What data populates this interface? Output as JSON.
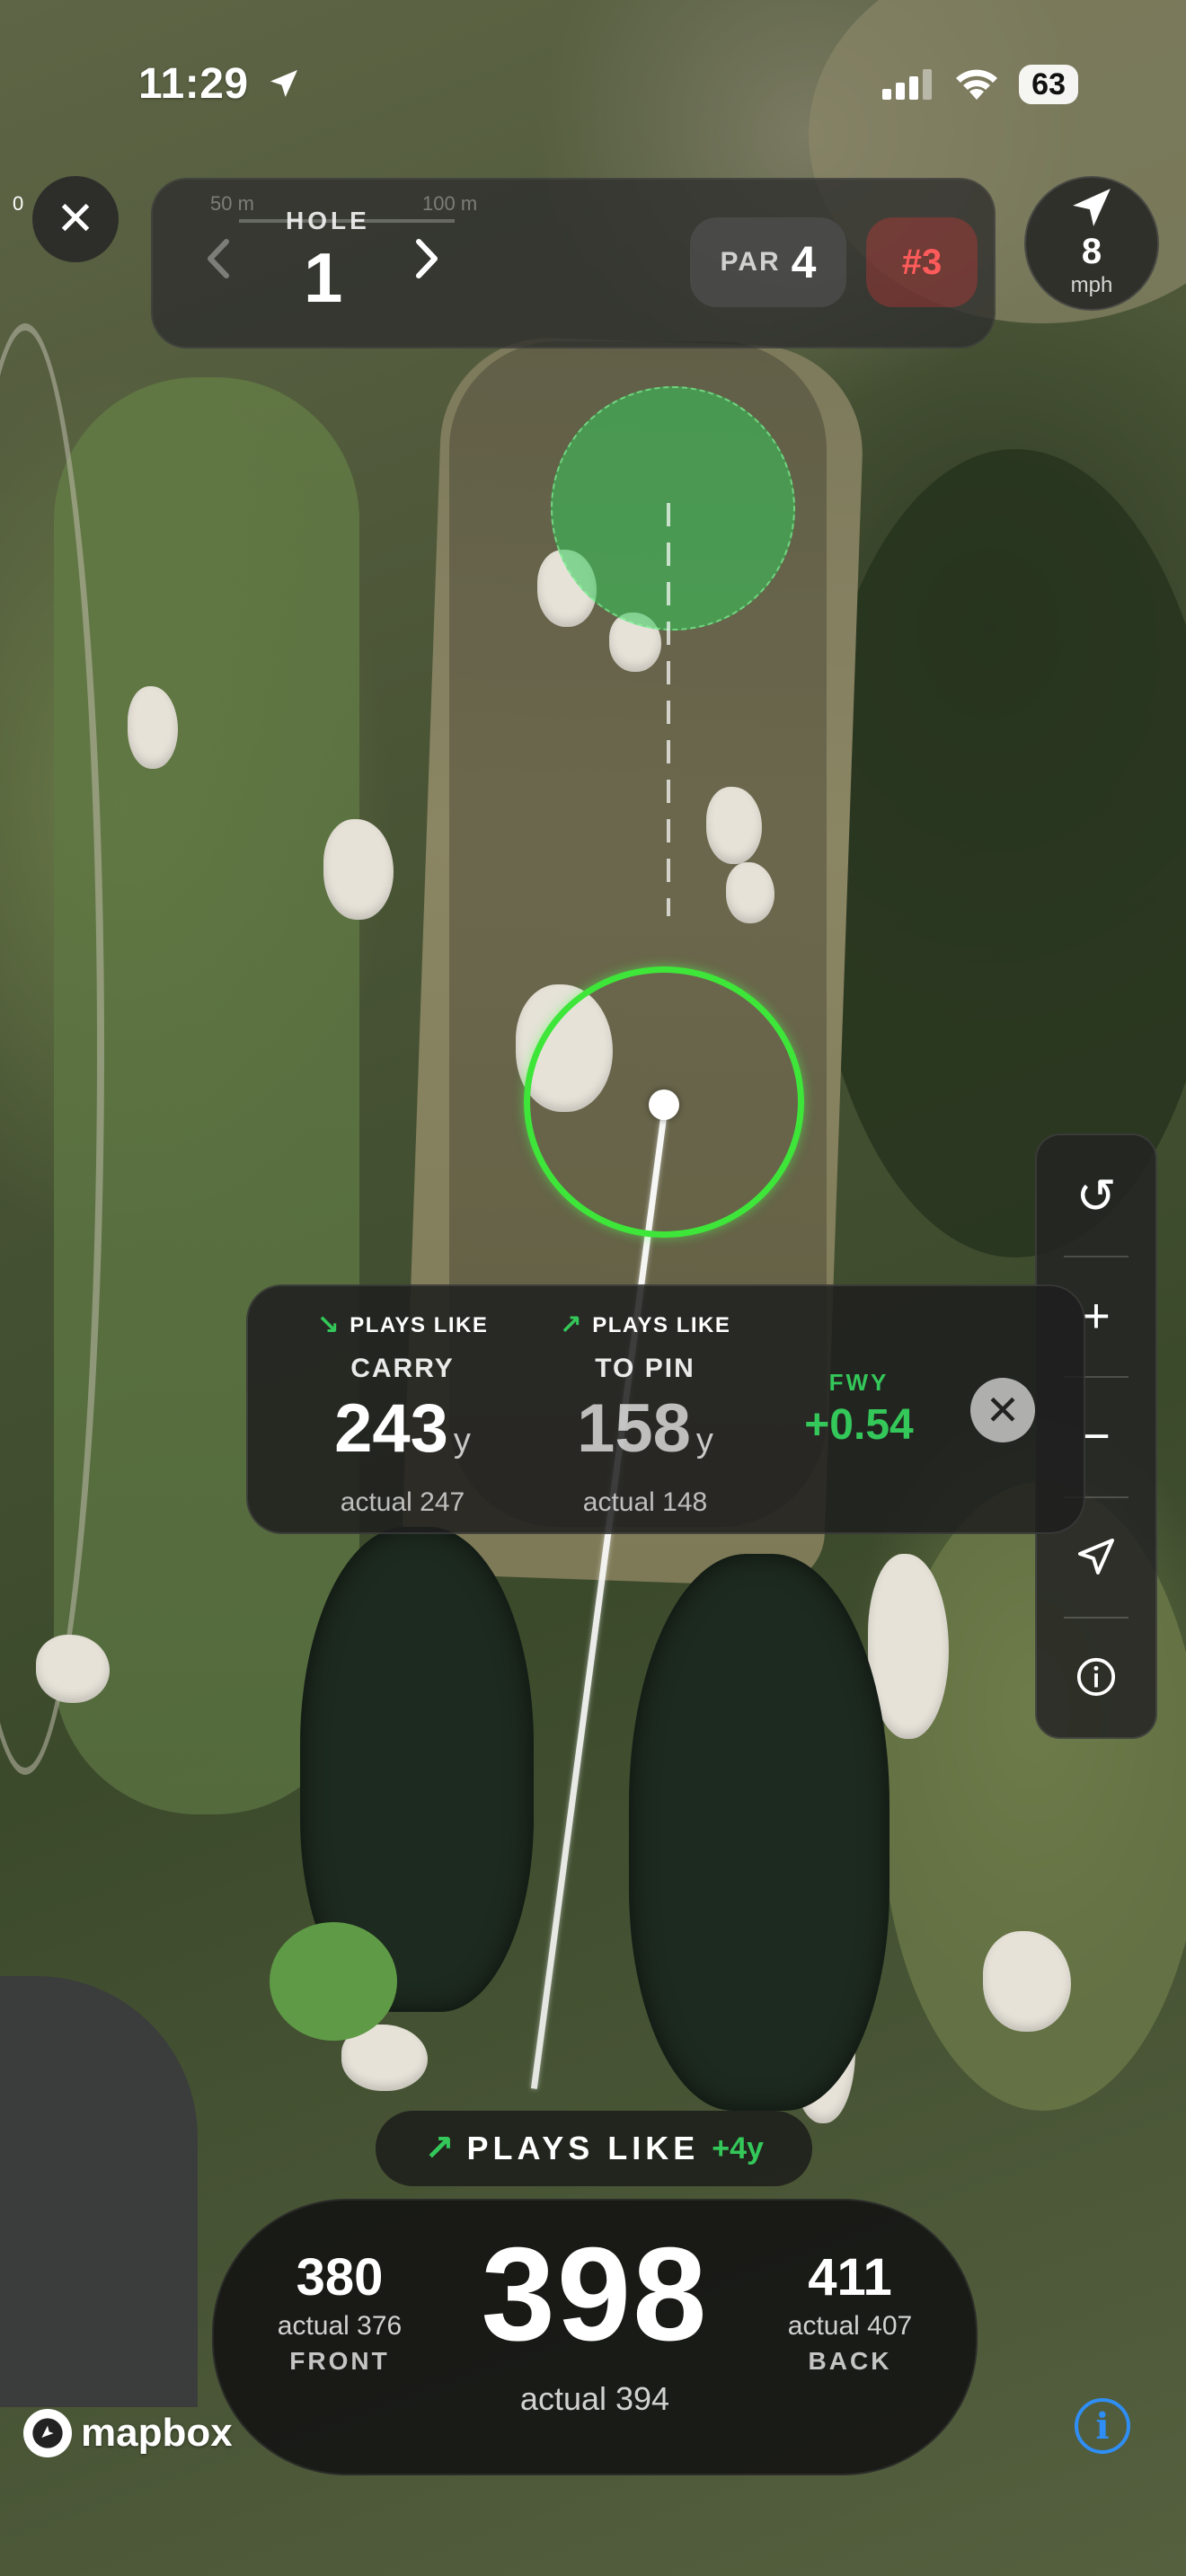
{
  "status_bar": {
    "time": "11:29",
    "battery": "63",
    "icons": [
      "location-arrow-icon",
      "cellular-signal-icon",
      "wifi-icon",
      "battery-icon"
    ]
  },
  "map": {
    "scale_zero": "0",
    "scale_left": "50 m",
    "scale_right": "100 m",
    "colors": {
      "target_ring": "#3ee63a",
      "green_zone": "#34c759",
      "accent_green": "#34c759",
      "hcp_red": "#ff5b5b",
      "info_blue": "#2f8ef5"
    }
  },
  "close_button": {
    "icon": "close-icon",
    "label": "✕"
  },
  "hole_header": {
    "label": "HOLE",
    "number": "1",
    "prev_icon": "chevron-left-icon",
    "next_icon": "chevron-right-icon",
    "par_label": "PAR",
    "par_value": "4",
    "handicap": "#3"
  },
  "wind": {
    "speed": "8",
    "unit": "mph",
    "icon": "wind-direction-arrow-icon"
  },
  "toolbar": {
    "items": [
      {
        "name": "reset-rotation",
        "icon": "rotate-ccw-icon",
        "glyph": "↺"
      },
      {
        "name": "zoom-in",
        "icon": "plus-icon",
        "glyph": "+"
      },
      {
        "name": "zoom-out",
        "icon": "minus-icon",
        "glyph": "−"
      },
      {
        "name": "locate",
        "icon": "location-arrow-icon",
        "glyph": "➤"
      },
      {
        "name": "info",
        "icon": "info-icon",
        "glyph": "ⓘ"
      }
    ]
  },
  "plays_like_card": {
    "carry": {
      "header": "PLAYS LIKE",
      "arrow": "↘",
      "label": "CARRY",
      "value": "243",
      "unit": "y",
      "actual": "actual 247"
    },
    "to_pin": {
      "header": "PLAYS LIKE",
      "arrow": "↗",
      "label": "TO PIN",
      "value": "158",
      "unit": "y",
      "actual": "actual 148"
    },
    "fwy": {
      "label": "FWY",
      "value": "+0.54"
    },
    "close_glyph": "✕"
  },
  "plays_like_pill": {
    "arrow": "↗",
    "label": "PLAYS LIKE",
    "value": "+4y"
  },
  "distances": {
    "front": {
      "value": "380",
      "actual": "actual 376",
      "label": "FRONT"
    },
    "center": {
      "value": "398",
      "actual": "actual 394"
    },
    "back": {
      "value": "411",
      "actual": "actual 407",
      "label": "BACK"
    }
  },
  "attribution": {
    "brand": "mapbox",
    "info_glyph": "i"
  }
}
